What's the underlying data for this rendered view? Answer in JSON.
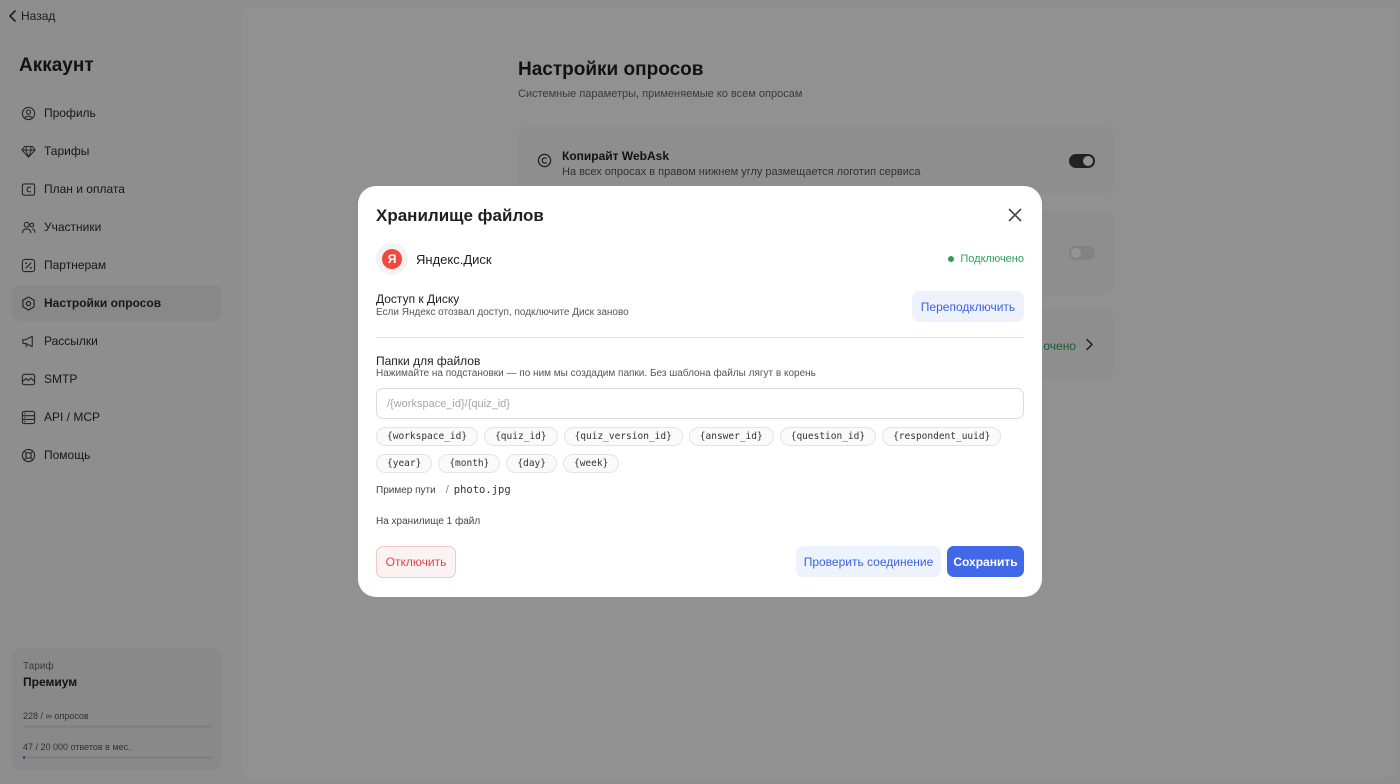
{
  "sidebar": {
    "back_label": "Назад",
    "title": "Аккаунт",
    "items": [
      {
        "label": "Профиль",
        "icon": "user-circle-icon"
      },
      {
        "label": "Тарифы",
        "icon": "diamond-icon"
      },
      {
        "label": "План и оплата",
        "icon": "billing-icon"
      },
      {
        "label": "Участники",
        "icon": "users-icon"
      },
      {
        "label": "Партнерам",
        "icon": "percent-icon"
      },
      {
        "label": "Настройки опросов",
        "icon": "settings-icon",
        "active": true
      },
      {
        "label": "Рассылки",
        "icon": "megaphone-icon"
      },
      {
        "label": "SMTP",
        "icon": "mail-icon"
      },
      {
        "label": "API / MCP",
        "icon": "server-icon"
      },
      {
        "label": "Помощь",
        "icon": "help-icon"
      }
    ],
    "plan": {
      "label": "Тариф",
      "name": "Премиум",
      "usage_surveys": "228 / ∞ опросов",
      "usage_surveys_fraction": 0.0,
      "usage_answers": "47 / 20 000 ответов в мес.",
      "usage_answers_fraction": 0.0024
    }
  },
  "main": {
    "title": "Настройки опросов",
    "subtitle": "Системные параметры, применяемые ко всем опросам",
    "copyright": {
      "title": "Копирайт WebAsk",
      "description": "На всех опросах в правом нижнем углу размещается логотип сервиса",
      "enabled": true
    },
    "storage_card_status": "очено"
  },
  "modal": {
    "title": "Хранилище файлов",
    "provider": {
      "name": "Яндекс.Диск",
      "logo_letter": "Я",
      "status": "Подключено"
    },
    "access": {
      "title": "Доступ к Диску",
      "description": "Если Яндекс отозвал доступ, подключите Диск заново",
      "reconnect_label": "Переподключить"
    },
    "folders": {
      "title": "Папки для файлов",
      "description": "Нажимайте на подстановки — по ним мы создадим папки. Без шаблона файлы лягут в корень",
      "placeholder": "/{workspace_id}/{quiz_id}",
      "value": "",
      "tokens": [
        "{workspace_id}",
        "{quiz_id}",
        "{quiz_version_id}",
        "{answer_id}",
        "{question_id}",
        "{respondent_uuid}",
        "{year}",
        "{month}",
        "{day}",
        "{week}"
      ]
    },
    "example": {
      "label": "Пример пути",
      "separator": "/",
      "path": "photo.jpg"
    },
    "storage_info": "На хранилище 1 файл",
    "buttons": {
      "disconnect": "Отключить",
      "check": "Проверить соединение",
      "save": "Сохранить"
    }
  },
  "colors": {
    "accent": "#4169e7",
    "success": "#2f9e5c",
    "danger": "#e0454a"
  }
}
